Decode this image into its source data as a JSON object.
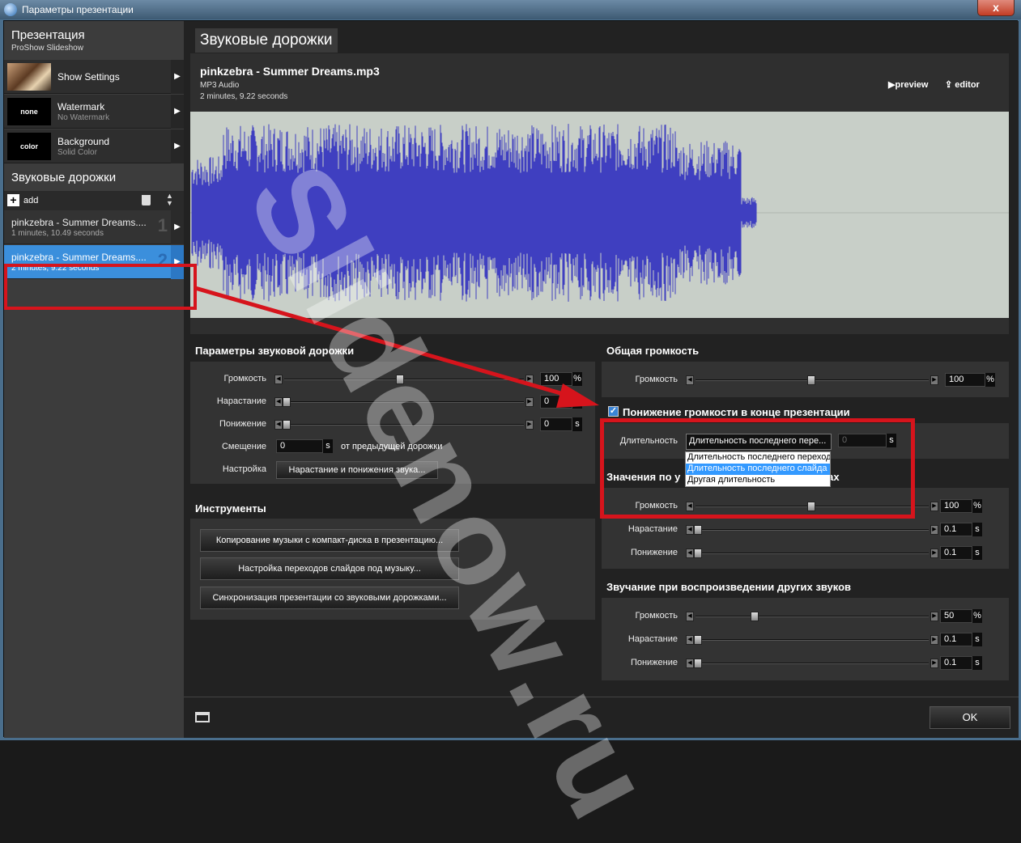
{
  "window": {
    "title": "Параметры презентации",
    "close_label": "x"
  },
  "sidebar": {
    "header": "Презентация",
    "subheader": "ProShow Slideshow",
    "items": [
      {
        "thumb": "",
        "label": "Show Settings",
        "sub": ""
      },
      {
        "thumb": "none",
        "label": "Watermark",
        "sub": "No Watermark"
      },
      {
        "thumb": "color",
        "label": "Background",
        "sub": "Solid Color"
      }
    ],
    "tracks_header": "Звуковые дорожки",
    "add_label": "add",
    "tracks": [
      {
        "name": "pinkzebra - Summer Dreams....",
        "duration": "1 minutes, 10.49 seconds",
        "num": "1"
      },
      {
        "name": "pinkzebra - Summer Dreams....",
        "duration": "2 minutes, 9.22 seconds",
        "num": "2"
      }
    ]
  },
  "main": {
    "title": "Звуковые дорожки",
    "file": {
      "name": "pinkzebra - Summer Dreams.mp3",
      "type": "MP3 Audio",
      "duration": "2 minutes, 9.22 seconds",
      "preview_label": "preview",
      "editor_label": "editor"
    },
    "track_params": {
      "title": "Параметры звуковой дорожки",
      "volume_label": "Громкость",
      "volume": "100",
      "volume_level": 0.58,
      "fadein_label": "Нарастание",
      "fadein": "0",
      "fadeout_label": "Понижение",
      "fadeout": "0",
      "offset_label": "Смещение",
      "offset": "0",
      "offset_suffix": "от предыдущей дорожки",
      "setup_label": "Настройка",
      "setup_button": "Нарастание и понижения звука..."
    },
    "overall": {
      "title": "Общая громкость",
      "volume_label": "Громкость",
      "volume": "100",
      "volume_level": 0.5
    },
    "fade_end": {
      "checkbox_label": "Понижение громкости в конце презентации",
      "checked": true,
      "duration_label": "Длительность",
      "select_value": "Длительность последнего пере...",
      "value": "0",
      "options": [
        "Длительность последнего переход",
        "Длительность последнего слайда",
        "Другая длительность"
      ],
      "selected_option": 1
    },
    "defaults": {
      "title_visible": "Значения по у",
      "title_tail": "лайдах",
      "volume_label": "Громкость",
      "volume": "100",
      "volume_level": 0.5,
      "fadein_label": "Нарастание",
      "fadein": "0.1",
      "fadeout_label": "Понижение",
      "fadeout": "0.1"
    },
    "other": {
      "title": "Звучание при воспроизведении других звуков",
      "volume_label": "Громкость",
      "volume": "50",
      "volume_level": 0.25,
      "fadein_label": "Нарастание",
      "fadein": "0.1",
      "fadeout_label": "Понижение",
      "fadeout": "0.1"
    },
    "tools": {
      "title": "Инструменты",
      "buttons": [
        "Копирование музыки с компакт-диска в презентацию...",
        "Настройка переходов слайдов под музыку...",
        "Синхронизация презентации со звуковыми дорожками..."
      ]
    },
    "ok_label": "OK",
    "unit_pct": "%",
    "unit_s": "s",
    "watermark": "Slidenow.ru",
    "colors": {
      "waveform": "#3f3fc0",
      "waveform_bg": "#c8cfc8",
      "selection": "#3b8fdc",
      "annotation": "#d6141c"
    }
  }
}
